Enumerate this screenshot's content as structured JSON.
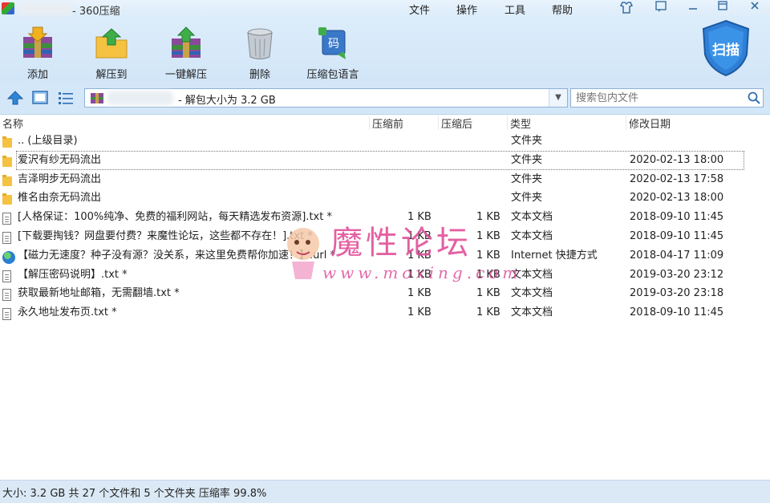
{
  "window": {
    "title": "360压缩",
    "menus": [
      "文件",
      "操作",
      "工具",
      "帮助"
    ]
  },
  "toolbar": {
    "items": [
      {
        "label": "添加",
        "icon": "add-archive-icon"
      },
      {
        "label": "解压到",
        "icon": "extract-to-icon"
      },
      {
        "label": "一键解压",
        "icon": "one-click-extract-icon"
      },
      {
        "label": "删除",
        "icon": "delete-bin-icon"
      },
      {
        "label": "压缩包语言",
        "icon": "archive-language-icon"
      }
    ],
    "scan_label": "扫描"
  },
  "address": {
    "text": "- 解包大小为 3.2 GB"
  },
  "search": {
    "placeholder": "搜索包内文件"
  },
  "columns": [
    "名称",
    "压缩前",
    "压缩后",
    "类型",
    "修改日期"
  ],
  "files": [
    {
      "name": ".. (上级目录)",
      "before": "",
      "after": "",
      "type": "文件夹",
      "date": "",
      "icon": "folder"
    },
    {
      "name": "爱沢有纱无码流出",
      "before": "",
      "after": "",
      "type": "文件夹",
      "date": "2020-02-13 18:00",
      "icon": "folder",
      "selected": true
    },
    {
      "name": "吉泽明步无码流出",
      "before": "",
      "after": "",
      "type": "文件夹",
      "date": "2020-02-13 17:58",
      "icon": "folder"
    },
    {
      "name": "椎名由奈无码流出",
      "before": "",
      "after": "",
      "type": "文件夹",
      "date": "2020-02-13 18:00",
      "icon": "folder"
    },
    {
      "name": "[人格保证：100%纯净、免费的福利网站，每天精选发布资源].txt *",
      "before": "1 KB",
      "after": "1 KB",
      "type": "文本文档",
      "date": "2018-09-10 11:45",
      "icon": "doc"
    },
    {
      "name": "[下载要掏钱？网盘要付费？来魔性论坛，这些都不存在！].txt *",
      "before": "1 KB",
      "after": "1 KB",
      "type": "文本文档",
      "date": "2018-09-10 11:45",
      "icon": "doc"
    },
    {
      "name": "【磁力无速度？种子没有源？没关系，来这里免费帮你加速！】.url *",
      "before": "1 KB",
      "after": "1 KB",
      "type": "Internet 快捷方式",
      "date": "2018-04-17 11:09",
      "icon": "globe"
    },
    {
      "name": "【解压密码说明】.txt *",
      "before": "1 KB",
      "after": "1 KB",
      "type": "文本文档",
      "date": "2019-03-20 23:12",
      "icon": "doc"
    },
    {
      "name": "获取最新地址邮箱，无需翻墙.txt *",
      "before": "1 KB",
      "after": "1 KB",
      "type": "文本文档",
      "date": "2019-03-20 23:18",
      "icon": "doc"
    },
    {
      "name": "永久地址发布页.txt *",
      "before": "1 KB",
      "after": "1 KB",
      "type": "文本文档",
      "date": "2018-09-10 11:45",
      "icon": "doc"
    }
  ],
  "watermark": {
    "title": "魔性论坛",
    "url": "www.moxing.com"
  },
  "status": {
    "text": "大小: 3.2 GB 共 27 个文件和 5 个文件夹 压缩率 99.8%"
  },
  "colors": {
    "toolbar_bg": "#d2e6f8",
    "accent": "#2f6fb4",
    "watermark": "#e0509a"
  }
}
